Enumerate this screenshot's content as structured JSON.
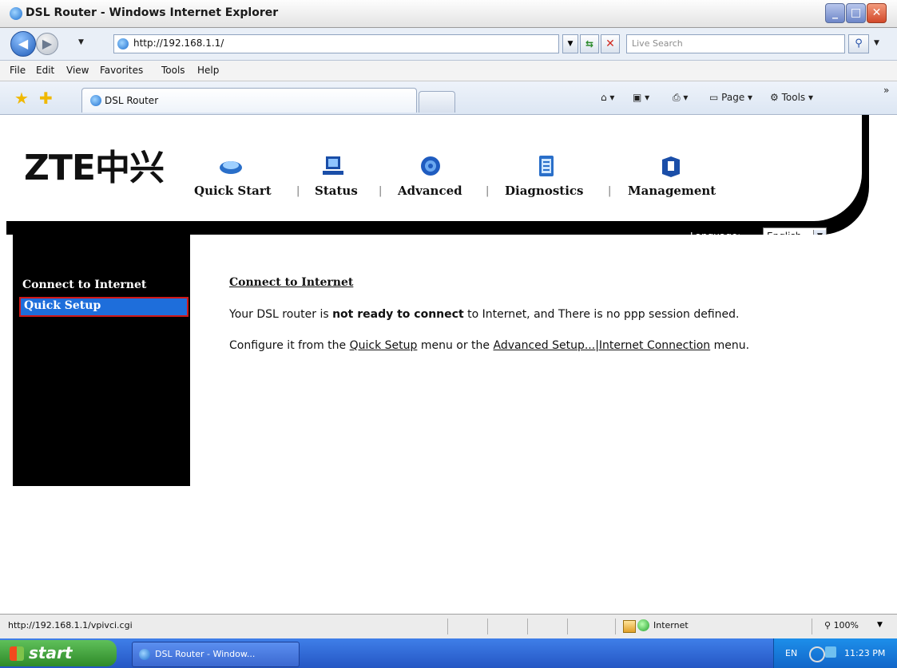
{
  "window": {
    "title": "DSL Router - Windows Internet Explorer",
    "min_icon": "minimize-icon",
    "max_icon": "maximize-icon",
    "close_icon": "close-icon"
  },
  "addressbar": {
    "url": "http://192.168.1.1/",
    "search_placeholder": "Live Search"
  },
  "menubar": {
    "items": [
      "File",
      "Edit",
      "View",
      "Favorites",
      "Tools",
      "Help"
    ]
  },
  "favbar": {
    "tab_title": "DSL Router",
    "page_label": "Page",
    "tools_label": "Tools"
  },
  "router": {
    "logo": "ZTE中兴",
    "nav": [
      "Quick Start",
      "Status",
      "Advanced",
      "Diagnostics",
      "Management"
    ],
    "nav_sep": "|",
    "language_label": "Language:",
    "language_value": "English",
    "sidebar": {
      "heading": "Connect to Internet",
      "selected": "Quick Setup"
    },
    "content": {
      "title": "Connect to Internet",
      "line1_pre": "Your DSL router is ",
      "line1_bold": "not ready to connect",
      "line1_post": " to Internet, and There is no ppp session defined.",
      "line2_pre": "Configure it from the ",
      "line2_link1": "Quick Setup",
      "line2_mid": " menu or the ",
      "line2_link2": "Advanced Setup...|Internet Connection",
      "line2_post": " menu."
    }
  },
  "statusbar": {
    "url": "http://192.168.1.1/vpivci.cgi",
    "zone": "Internet",
    "zoom": "100%"
  },
  "taskbar": {
    "start": "start",
    "task": "DSL Router - Window...",
    "lang": "EN",
    "time": "11:23 PM"
  },
  "colors": {
    "accent": "#1e6edb",
    "highlight_border": "#d01818",
    "page_black": "#000000"
  }
}
